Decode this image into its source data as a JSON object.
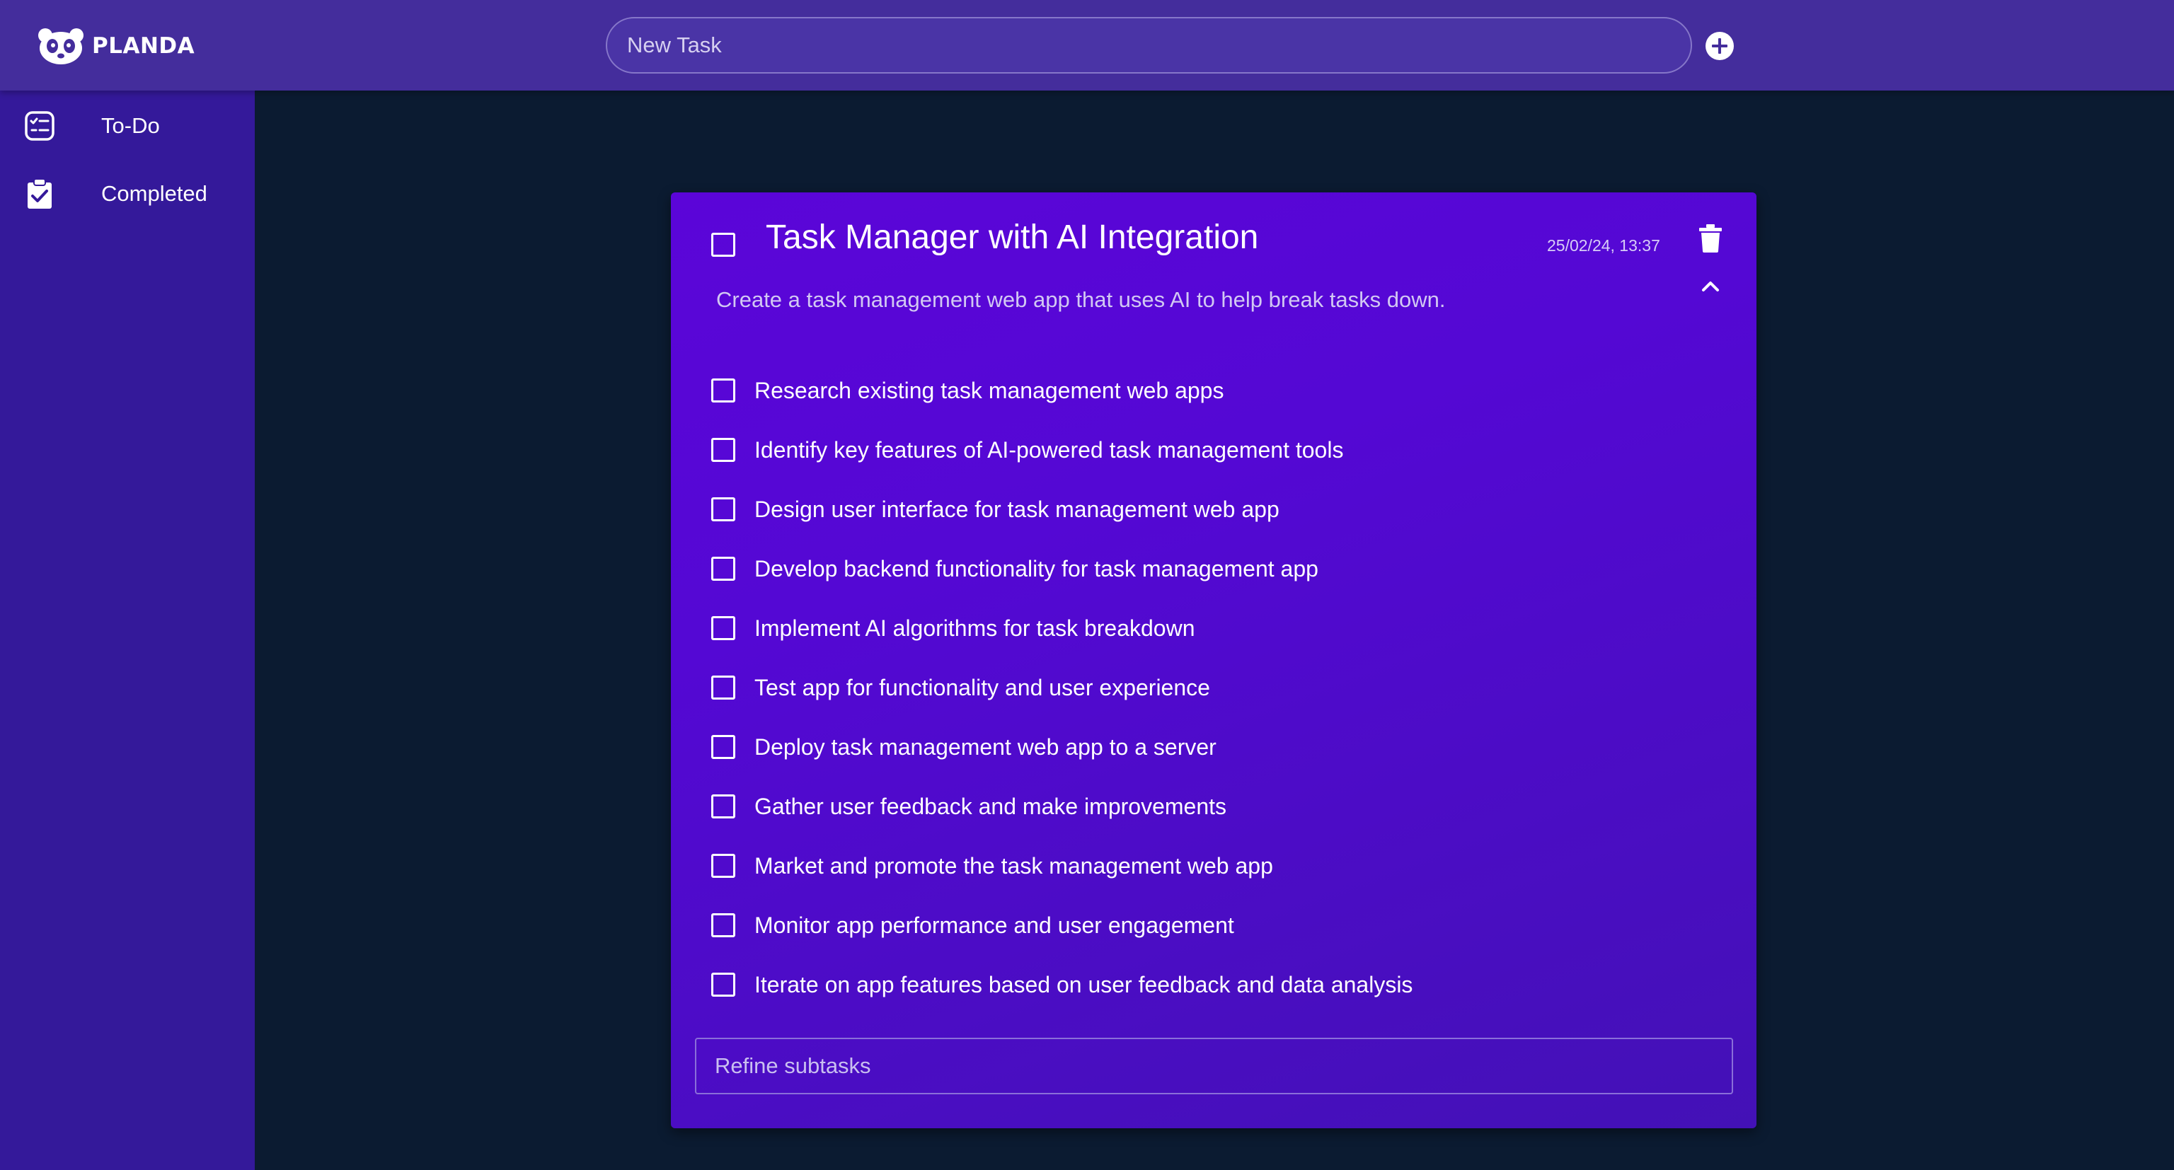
{
  "app": {
    "brand": "PLANDA"
  },
  "header": {
    "new_task_placeholder": "New Task",
    "add_icon": "plus-circle-icon"
  },
  "sidebar": {
    "items": [
      {
        "label": "To-Do",
        "icon": "checklist-icon",
        "selected": true
      },
      {
        "label": "Completed",
        "icon": "clipboard-check-icon",
        "selected": false
      }
    ]
  },
  "task": {
    "title": "Task Manager with AI Integration",
    "timestamp": "25/02/24, 13:37",
    "description": "Create a task management web app that uses AI to help break tasks down.",
    "completed": false,
    "expanded": true,
    "subtasks": [
      {
        "label": "Research existing task management web apps",
        "checked": false
      },
      {
        "label": "Identify key features of AI-powered task management tools",
        "checked": false
      },
      {
        "label": "Design user interface for task management web app",
        "checked": false
      },
      {
        "label": "Develop backend functionality for task management app",
        "checked": false
      },
      {
        "label": "Implement AI algorithms for task breakdown",
        "checked": false
      },
      {
        "label": "Test app for functionality and user experience",
        "checked": false
      },
      {
        "label": "Deploy task management web app to a server",
        "checked": false
      },
      {
        "label": "Gather user feedback and make improvements",
        "checked": false
      },
      {
        "label": "Market and promote the task management web app",
        "checked": false
      },
      {
        "label": "Monitor app performance and user engagement",
        "checked": false
      },
      {
        "label": "Iterate on app features based on user feedback and data analysis",
        "checked": false
      }
    ],
    "refine_placeholder": "Refine subtasks"
  },
  "colors": {
    "page_background": "#0b1b31",
    "topbar": "#442d9c",
    "sidebar": "#34199a",
    "card_start": "#5b05d8",
    "card_end": "#4311b6"
  }
}
